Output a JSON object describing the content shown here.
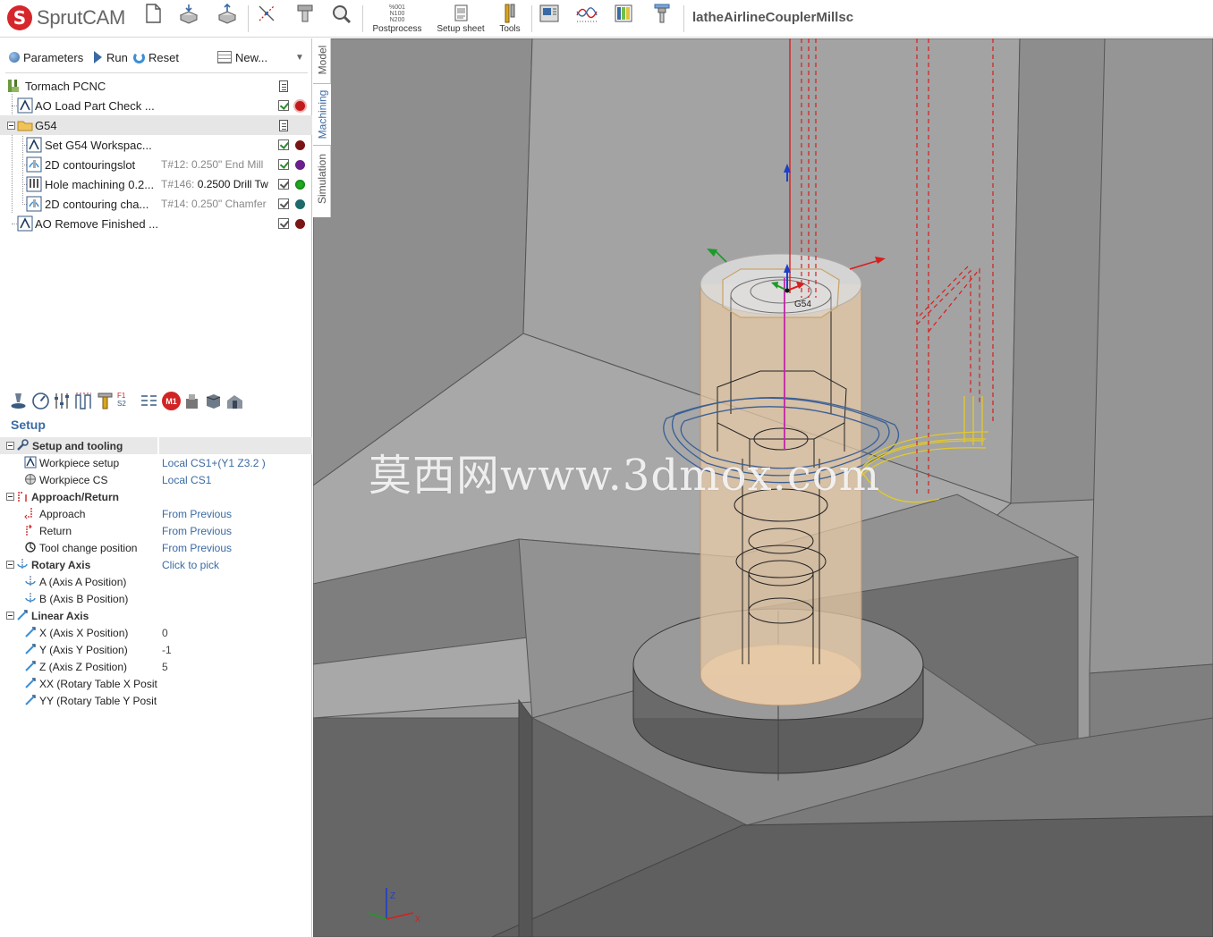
{
  "app": {
    "brand": "SprutCAM",
    "document_title": "latheAirlineCouplerMillsc"
  },
  "toolbar": {
    "postprocess_label": "Postprocess",
    "postprocess_code": "%001\nN100\nN200",
    "setup_sheet_label": "Setup sheet",
    "tools_label": "Tools"
  },
  "left_toolbar": {
    "parameters": "Parameters",
    "run": "Run",
    "reset": "Reset",
    "new": "New..."
  },
  "tree": {
    "machine": "Tormach PCNC",
    "items": [
      {
        "label": "AO Load Part Check ...",
        "tool": "",
        "tool_name": "",
        "status_color": "#c21a1a"
      },
      {
        "label": "G54",
        "tool": "",
        "tool_name": ""
      },
      {
        "label": "Set G54 Workspac...",
        "tool": "",
        "tool_name": "",
        "status_color": "#7a1515"
      },
      {
        "label": "2D contouringslot",
        "tool": "T#12: 0.250\" End Mill",
        "tool_name": "",
        "status_color": "#6a1f8a"
      },
      {
        "label": "Hole machining 0.2...",
        "tool": "T#146:",
        "tool_name": "0.2500 Drill Tw",
        "status_color": "#22aa22"
      },
      {
        "label": "2D contouring cha...",
        "tool": "T#14: 0.250\" Chamfer",
        "tool_name": "",
        "status_color": "#1f6a6a"
      },
      {
        "label": "AO Remove Finished ...",
        "tool": "",
        "tool_name": "",
        "status_color": "#7a1515"
      }
    ]
  },
  "op_toolbar": {
    "m1_badge": "M1",
    "f1_label": "F1",
    "s2_label": "S2"
  },
  "setup": {
    "title": "Setup",
    "groups": {
      "setup_tooling": "Setup and tooling",
      "approach_return": "Approach/Return",
      "rotary_axis": "Rotary Axis",
      "linear_axis": "Linear Axis"
    },
    "props": {
      "workpiece_setup": {
        "name": "Workpiece setup",
        "value": "Local CS1+(Y1 Z3.2 )"
      },
      "workpiece_cs": {
        "name": "Workpiece CS",
        "value": "Local CS1"
      },
      "approach": {
        "name": "Approach",
        "value": "From Previous"
      },
      "return": {
        "name": "Return",
        "value": "From Previous"
      },
      "tool_change": {
        "name": "Tool change position",
        "value": "From Previous"
      },
      "rotary_pick": {
        "value": "Click to pick"
      },
      "a_axis": {
        "name": "A (Axis A Position)",
        "value": ""
      },
      "b_axis": {
        "name": "B (Axis B Position)",
        "value": ""
      },
      "x_axis": {
        "name": "X (Axis X Position)",
        "value": "0"
      },
      "y_axis": {
        "name": "Y (Axis Y Position)",
        "value": "-1"
      },
      "z_axis": {
        "name": "Z (Axis Z Position)",
        "value": "5"
      },
      "xx_axis": {
        "name": "XX (Rotary Table X Posit",
        "value": ""
      },
      "yy_axis": {
        "name": "YY (Rotary Table Y Posit",
        "value": ""
      }
    }
  },
  "viewport": {
    "tabs": [
      "Model",
      "Machining",
      "Simulation"
    ],
    "active_tab": "Machining",
    "cs_label": "G54",
    "axis_z": "Z",
    "axis_x": "X",
    "watermark": "莫西网www.3dmox.com"
  }
}
